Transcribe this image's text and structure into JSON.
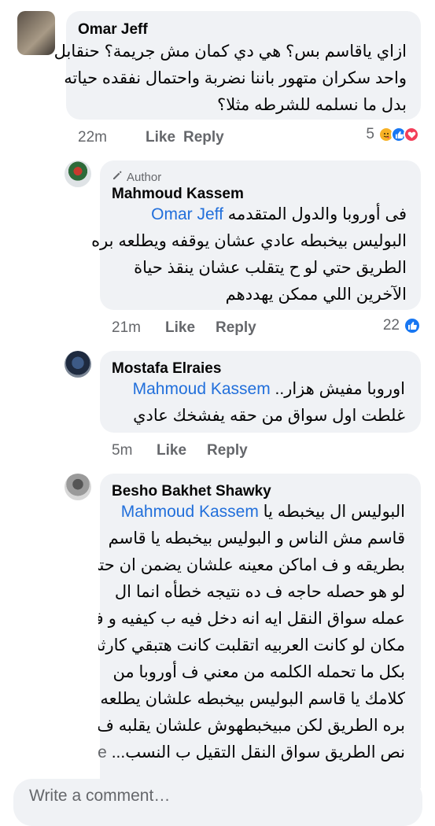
{
  "comments": [
    {
      "author": "Omar Jeff",
      "lines": [
        "ازاي ياقاسم بس؟ هي دي كمان مش جريمة؟ حنقابل",
        "واحد سكران متهور باننا نضربة واحتمال نفقده حياته",
        "بدل ما نسلمه للشرطه مثلا؟"
      ],
      "time": "22m",
      "like": "Like",
      "reply": "Reply",
      "reaction_count": "5",
      "reaction_icons": [
        "care-icon",
        "like-icon",
        "love-icon"
      ]
    },
    {
      "author": "Mahmoud Kassem",
      "badge": "Author",
      "mention": "Omar Jeff",
      "first_line_text": "فى أوروبا والدول المتقدمه",
      "lines": [
        "البوليس بيخبطه عادي عشان يوقفه ويطلعه بره",
        "الطريق حتي لو ح يتقلب عشان ينقذ حياة",
        "الآخرين اللي ممكن يهددهم"
      ],
      "time": "21m",
      "like": "Like",
      "reply": "Reply",
      "reaction_count": "22",
      "reaction_icons": [
        "like-icon"
      ]
    },
    {
      "author": "Mostafa Elraies",
      "mention": "Mahmoud Kassem",
      "first_line_text": "اوروبا مفيش هزار..",
      "lines": [
        "غلطت اول سواق من حقه يفشخك عادي"
      ],
      "time": "5m",
      "like": "Like",
      "reply": "Reply"
    },
    {
      "author": "Besho Bakhet Shawky",
      "mention": "Mahmoud Kassem",
      "first_line_text": "البوليس ال بيخبطه يا",
      "lines": [
        "قاسم مش الناس و البوليس بيخبطه يا قاسم",
        "بطريقه و ف اماكن معينه علشان يضمن ان حتي",
        "لو هو حصله حاجه ف ده نتيجه خطأه انما ال",
        "عمله سواق النقل ايه انه دخل فيه ب كيفيه و ف",
        "مكان لو كانت العربيه اتقلبت كانت هتبقي كارثه",
        "بكل ما تحمله الكلمه من معني ف أوروبا من",
        "كلامك يا قاسم البوليس بيخبطه علشان يطلعه",
        "بره الطريق لكن مبيخبطهوش علشان يقلبه ف",
        "نص الطريق سواق النقل التقيل ب النسب..."
      ],
      "see_more": "See more"
    }
  ],
  "composer": {
    "placeholder": "Write a comment…"
  },
  "colors": {
    "mention": "#216fdb",
    "bubble": "#f0f2f5",
    "meta": "#65676b"
  }
}
